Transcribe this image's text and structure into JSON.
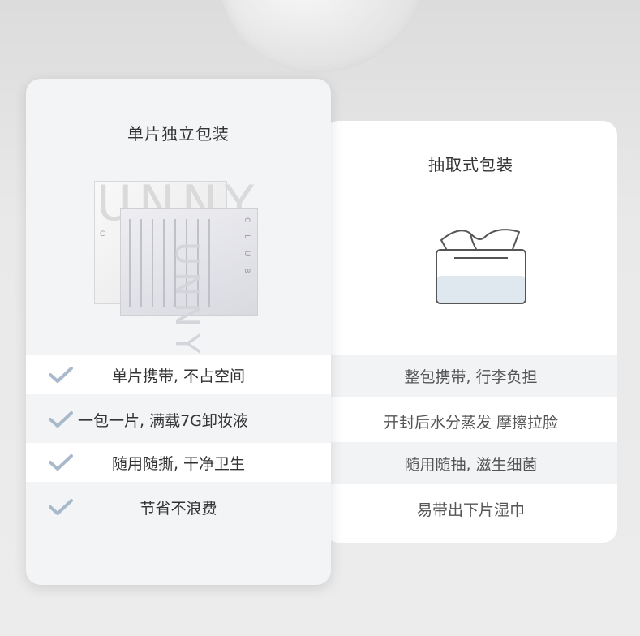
{
  "left_card": {
    "title": "单片独立包装",
    "illustration": {
      "brand_large": "UNNY",
      "brand_small": "C L U B"
    },
    "rows": [
      {
        "text": "单片携带, 不占空间",
        "icon": "check-icon"
      },
      {
        "text": "一包一片, 满载7G卸妆液",
        "icon": "check-icon"
      },
      {
        "text": "随用随撕, 干净卫生",
        "icon": "check-icon"
      },
      {
        "text": "节省不浪费",
        "icon": "check-icon"
      }
    ]
  },
  "right_card": {
    "title": "抽取式包装",
    "illustration": {
      "icon": "tissue-box-icon"
    },
    "rows": [
      {
        "text": "整包携带, 行李负担"
      },
      {
        "text": "开封后水分蒸发 摩擦拉脸"
      },
      {
        "text": "随用随抽, 滋生细菌"
      },
      {
        "text": "易带出下片湿巾"
      }
    ]
  },
  "colors": {
    "check": "#a9b9cc",
    "tissue_fill": "#dfe7ef",
    "outline": "#555555"
  }
}
